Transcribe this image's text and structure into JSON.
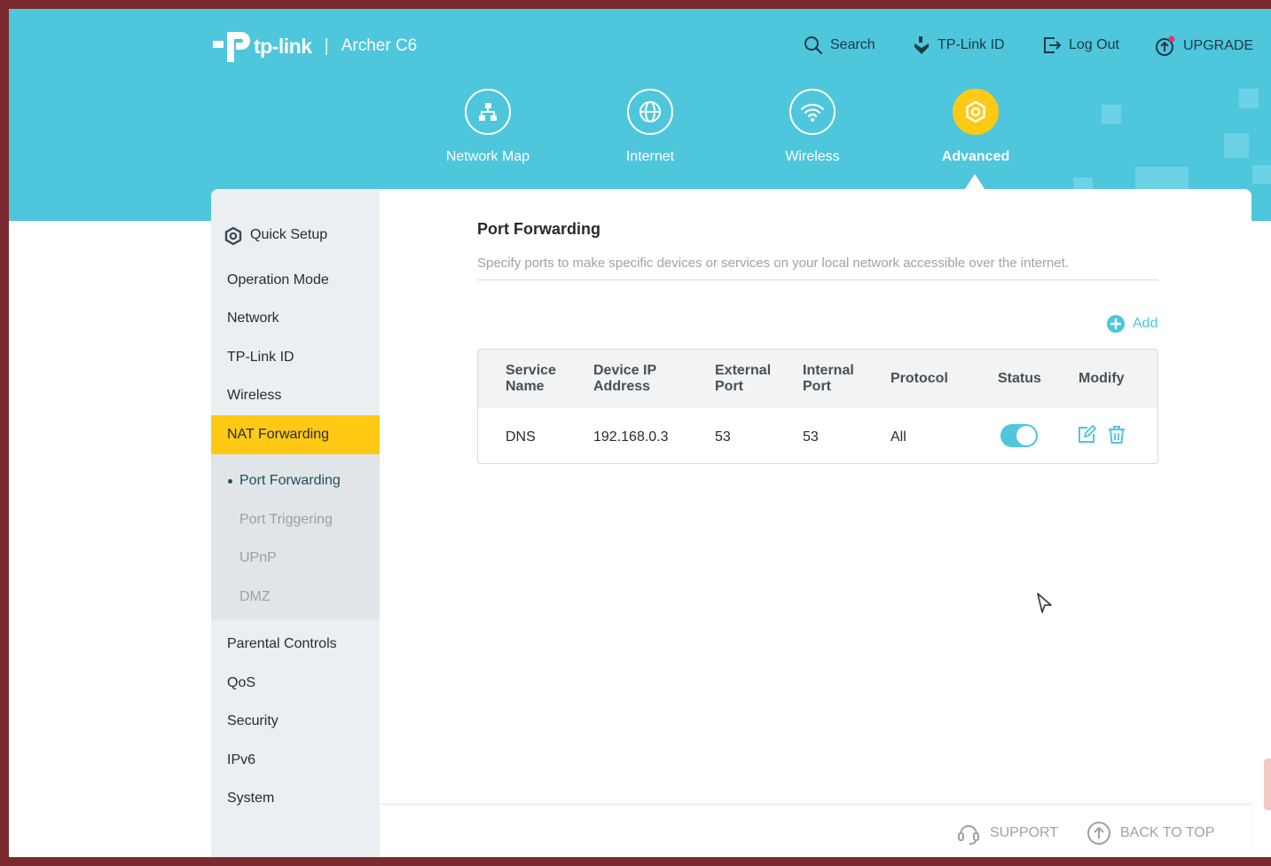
{
  "brand": {
    "logo_text": "tp-link",
    "separator": "|",
    "model": "Archer C6"
  },
  "top_links": [
    {
      "label": "Search",
      "icon": "search-icon"
    },
    {
      "label": "TP-Link ID",
      "icon": "tplink-id-icon"
    },
    {
      "label": "Log Out",
      "icon": "logout-icon"
    },
    {
      "label": "UPGRADE",
      "icon": "upgrade-icon"
    }
  ],
  "main_nav": [
    {
      "label": "Network Map",
      "icon": "network-map-icon"
    },
    {
      "label": "Internet",
      "icon": "globe-icon"
    },
    {
      "label": "Wireless",
      "icon": "wifi-icon"
    },
    {
      "label": "Advanced",
      "icon": "gear-icon",
      "active": true
    }
  ],
  "sidebar": {
    "items": [
      {
        "label": "Quick Setup",
        "icon": "gear-icon"
      },
      {
        "label": "Operation Mode"
      },
      {
        "label": "Network"
      },
      {
        "label": "TP-Link ID"
      },
      {
        "label": "Wireless"
      },
      {
        "label": "NAT Forwarding",
        "active": true
      },
      {
        "label": "Parental Controls"
      },
      {
        "label": "QoS"
      },
      {
        "label": "Security"
      },
      {
        "label": "IPv6"
      },
      {
        "label": "System"
      }
    ],
    "sub_items": [
      {
        "label": "Port Forwarding",
        "active": true
      },
      {
        "label": "Port Triggering"
      },
      {
        "label": "UPnP"
      },
      {
        "label": "DMZ"
      }
    ]
  },
  "content": {
    "title": "Port Forwarding",
    "description": "Specify ports to make specific devices or services on your local network accessible over the internet.",
    "add_label": "Add"
  },
  "table": {
    "headers": {
      "service_name": [
        "Service",
        "Name"
      ],
      "device_ip": [
        "Device IP",
        "Address"
      ],
      "external_port": [
        "External",
        "Port"
      ],
      "internal_port": [
        "Internal",
        "Port"
      ],
      "protocol": "Protocol",
      "status": "Status",
      "modify": "Modify"
    },
    "rows": [
      {
        "service_name": "DNS",
        "device_ip": "192.168.0.3",
        "external_port": "53",
        "internal_port": "53",
        "protocol": "All",
        "status": true
      }
    ]
  },
  "footer": {
    "support_label": "SUPPORT",
    "back_to_top_label": "BACK TO TOP"
  },
  "colors": {
    "accent": "#4ec6dc",
    "highlight": "#ffc914",
    "sidebar_bg": "#eceff1",
    "frame": "#7a2a2e"
  }
}
